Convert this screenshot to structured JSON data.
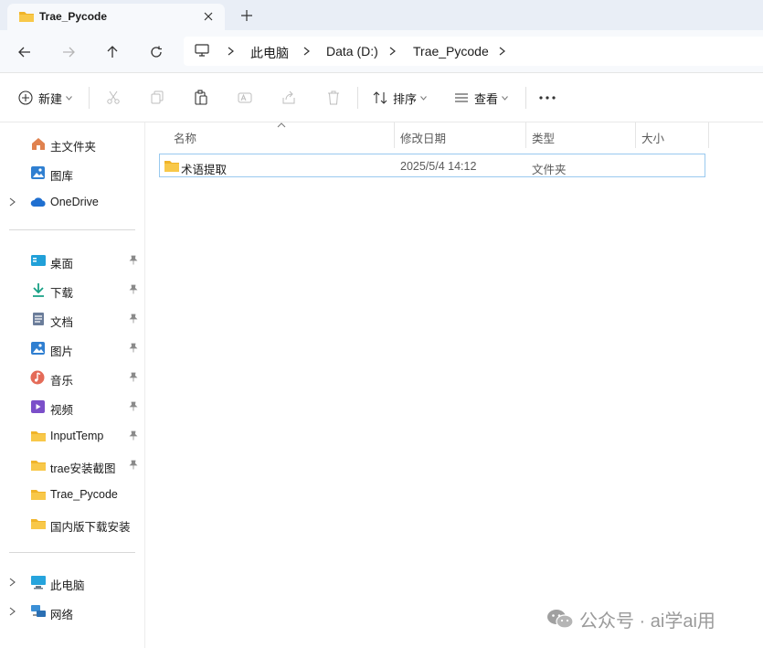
{
  "tab": {
    "title": "Trae_Pycode"
  },
  "address": {
    "crumbs": [
      "此电脑",
      "Data (D:)",
      "Trae_Pycode"
    ]
  },
  "toolbar": {
    "new_label": "新建",
    "sort_label": "排序",
    "view_label": "查看"
  },
  "sidebar": {
    "group1": [
      {
        "label": "主文件夹",
        "icon": "home-icon"
      },
      {
        "label": "图库",
        "icon": "gallery-icon"
      },
      {
        "label": "OneDrive",
        "icon": "cloud-icon"
      }
    ],
    "quick": [
      {
        "label": "桌面",
        "icon": "desktop-icon"
      },
      {
        "label": "下载",
        "icon": "download-icon"
      },
      {
        "label": "文档",
        "icon": "document-icon"
      },
      {
        "label": "图片",
        "icon": "picture-icon"
      },
      {
        "label": "音乐",
        "icon": "music-icon"
      },
      {
        "label": "视频",
        "icon": "video-icon"
      },
      {
        "label": "InputTemp",
        "icon": "folder-icon"
      },
      {
        "label": "trae安装截图",
        "icon": "folder-icon"
      },
      {
        "label": "Trae_Pycode",
        "icon": "folder-icon"
      },
      {
        "label": "国内版下载安装",
        "icon": "folder-icon"
      }
    ],
    "group3": [
      {
        "label": "此电脑",
        "icon": "pc-icon"
      },
      {
        "label": "网络",
        "icon": "network-icon"
      }
    ]
  },
  "columns": {
    "name": "名称",
    "modified": "修改日期",
    "type": "类型",
    "size": "大小"
  },
  "files": [
    {
      "name": "术语提取",
      "modified": "2025/5/4 14:12",
      "type": "文件夹",
      "size": ""
    }
  ],
  "watermark": {
    "text": "公众号 · ai学ai用"
  },
  "colors": {
    "folder": "#f8c849",
    "accent": "#0067c0",
    "selection_border": "#99c9ef"
  }
}
